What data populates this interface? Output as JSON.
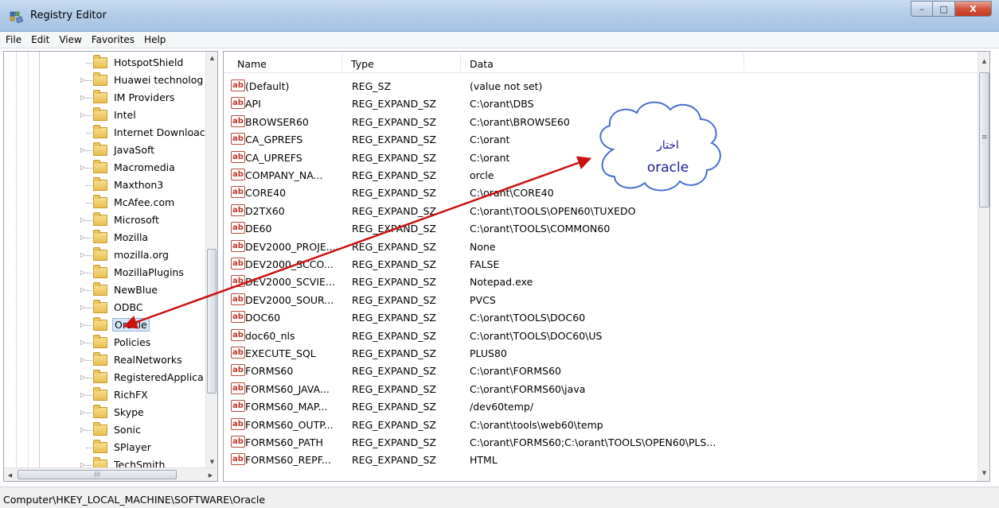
{
  "window": {
    "title": "Registry Editor",
    "buttons": {
      "minimize": "–",
      "maximize": "□",
      "close": "X"
    }
  },
  "menu": [
    "File",
    "Edit",
    "View",
    "Favorites",
    "Help"
  ],
  "tree": {
    "selected": "Oracle",
    "items": [
      {
        "label": "HotspotShield",
        "has_children": false
      },
      {
        "label": "Huawei technolog",
        "has_children": true
      },
      {
        "label": "IM Providers",
        "has_children": true
      },
      {
        "label": "Intel",
        "has_children": true
      },
      {
        "label": "Internet Downloac",
        "has_children": false
      },
      {
        "label": "JavaSoft",
        "has_children": true
      },
      {
        "label": "Macromedia",
        "has_children": true
      },
      {
        "label": "Maxthon3",
        "has_children": false
      },
      {
        "label": "McAfee.com",
        "has_children": false
      },
      {
        "label": "Microsoft",
        "has_children": true
      },
      {
        "label": "Mozilla",
        "has_children": true
      },
      {
        "label": "mozilla.org",
        "has_children": true
      },
      {
        "label": "MozillaPlugins",
        "has_children": true
      },
      {
        "label": "NewBlue",
        "has_children": true
      },
      {
        "label": "ODBC",
        "has_children": true
      },
      {
        "label": "Oracle",
        "has_children": true
      },
      {
        "label": "Policies",
        "has_children": true
      },
      {
        "label": "RealNetworks",
        "has_children": true
      },
      {
        "label": "RegisteredApplica",
        "has_children": true
      },
      {
        "label": "RichFX",
        "has_children": true
      },
      {
        "label": "Skype",
        "has_children": true
      },
      {
        "label": "Sonic",
        "has_children": true
      },
      {
        "label": "SPlayer",
        "has_children": false
      },
      {
        "label": "TechSmith",
        "has_children": true
      }
    ]
  },
  "list": {
    "columns": [
      "Name",
      "Type",
      "Data"
    ],
    "rows": [
      {
        "name": "(Default)",
        "type": "REG_SZ",
        "data": "(value not set)"
      },
      {
        "name": "API",
        "type": "REG_EXPAND_SZ",
        "data": "C:\\orant\\DBS"
      },
      {
        "name": "BROWSER60",
        "type": "REG_EXPAND_SZ",
        "data": "C:\\orant\\BROWSE60"
      },
      {
        "name": "CA_GPREFS",
        "type": "REG_EXPAND_SZ",
        "data": "C:\\orant"
      },
      {
        "name": "CA_UPREFS",
        "type": "REG_EXPAND_SZ",
        "data": "C:\\orant"
      },
      {
        "name": "COMPANY_NA...",
        "type": "REG_EXPAND_SZ",
        "data": "orcle"
      },
      {
        "name": "CORE40",
        "type": "REG_EXPAND_SZ",
        "data": "C:\\orant\\CORE40"
      },
      {
        "name": "D2TX60",
        "type": "REG_EXPAND_SZ",
        "data": "C:\\orant\\TOOLS\\OPEN60\\TUXEDO"
      },
      {
        "name": "DE60",
        "type": "REG_EXPAND_SZ",
        "data": "C:\\orant\\TOOLS\\COMMON60"
      },
      {
        "name": "DEV2000_PROJE...",
        "type": "REG_EXPAND_SZ",
        "data": "None"
      },
      {
        "name": "DEV2000_SCCO...",
        "type": "REG_EXPAND_SZ",
        "data": "FALSE"
      },
      {
        "name": "DEV2000_SCVIE...",
        "type": "REG_EXPAND_SZ",
        "data": "Notepad.exe"
      },
      {
        "name": "DEV2000_SOUR...",
        "type": "REG_EXPAND_SZ",
        "data": "PVCS"
      },
      {
        "name": "DOC60",
        "type": "REG_EXPAND_SZ",
        "data": "C:\\orant\\TOOLS\\DOC60"
      },
      {
        "name": "doc60_nls",
        "type": "REG_EXPAND_SZ",
        "data": "C:\\orant\\TOOLS\\DOC60\\US"
      },
      {
        "name": "EXECUTE_SQL",
        "type": "REG_EXPAND_SZ",
        "data": "PLUS80"
      },
      {
        "name": "FORMS60",
        "type": "REG_EXPAND_SZ",
        "data": "C:\\orant\\FORMS60"
      },
      {
        "name": "FORMS60_JAVA...",
        "type": "REG_EXPAND_SZ",
        "data": "C:\\orant\\FORMS60\\java"
      },
      {
        "name": "FORMS60_MAP...",
        "type": "REG_EXPAND_SZ",
        "data": "/dev60temp/"
      },
      {
        "name": "FORMS60_OUTP...",
        "type": "REG_EXPAND_SZ",
        "data": "C:\\orant\\tools\\web60\\temp"
      },
      {
        "name": "FORMS60_PATH",
        "type": "REG_EXPAND_SZ",
        "data": "C:\\orant\\FORMS60;C:\\orant\\TOOLS\\OPEN60\\PLS..."
      },
      {
        "name": "FORMS60_REPF...",
        "type": "REG_EXPAND_SZ",
        "data": "HTML"
      }
    ]
  },
  "status": {
    "path": "Computer\\HKEY_LOCAL_MACHINE\\SOFTWARE\\Oracle"
  },
  "annotation": {
    "line1": "اختار",
    "line2": "oracle",
    "arrow_color": "#cc1111",
    "text_color": "#1a1a99"
  },
  "colors": {
    "selection": "#d7e7fa",
    "titlebar": "#b4cde9",
    "close_button": "#c23a22"
  }
}
